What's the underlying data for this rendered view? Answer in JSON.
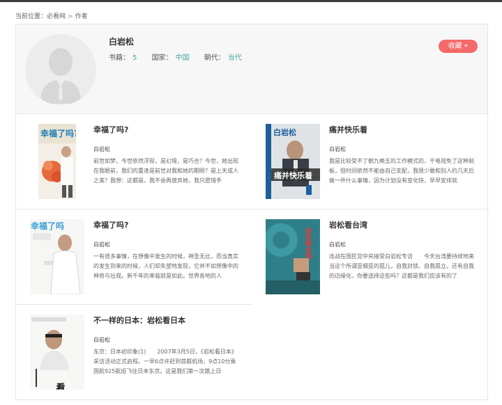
{
  "breadcrumb": {
    "prefix": "当前位置：",
    "home": "必看网",
    "separator": ">",
    "current": "作者"
  },
  "author": {
    "name": "白岩松",
    "books_label": "书籍：",
    "books_count": "5",
    "country_label": "国家：",
    "country": "中国",
    "dynasty_label": "朝代：",
    "dynasty": "当代",
    "favorite_label": "收藏 +"
  },
  "books": [
    {
      "title": "幸福了吗?",
      "author": "白岩松",
      "desc": "前世如梦。今世依然浮现，是幻境，是巧合？今世，她出现在我眼前，我们的重逢是前世对我和她的期颐？是上天成人之美？我想：这都是。我不会再放弃她，我只愿惜手",
      "cover_text": "幸福了吗?"
    },
    {
      "title": "痛并快乐着",
      "author": "白岩松",
      "desc": "我是比较受不了朝九晚五的工作模式的，干电视免了这种刻板，但时间依然不能由自己支配，我很少敢和别人约几天后做一件什么事情，因为计划没有变化快，早早安排就",
      "cover_text": "痛并快乐着"
    },
    {
      "title": "幸福了吗?",
      "author": "白岩松",
      "desc": "一有很多事情，在想像中发生的时候，神圣无比，而当真实的发生到来的时候，人们却失望地发现，它并不如想像中的神奇与壮观。新千年的来临就是如此。世界各地的人",
      "cover_text": "幸福了吗"
    },
    {
      "title": "岩松看台湾",
      "author": "白岩松",
      "desc": "连战在国民党中央接受白岩松专访　　今天台湾要持续地来当这个所谓亚细亚的孤儿，自我封锁、自我孤立，还有自我的边缘化，你要选择这些吗？这都是我们应该有的了",
      "cover_text": "岩松看台湾"
    },
    {
      "title": "不一样的日本：岩松看日本",
      "author": "白岩松",
      "desc": "东京：日本初印象(1)　　2007年3月5日，《岩松看日本》采访活动正式启程。一早6点许赶到首都机场，9点10分乘国航925航班飞往日本东京。这是我们第一次踏上日",
      "cover_text": "看日本"
    }
  ],
  "colors": {
    "accent": "#4aa6a0",
    "favorite": "#f56a6a"
  }
}
